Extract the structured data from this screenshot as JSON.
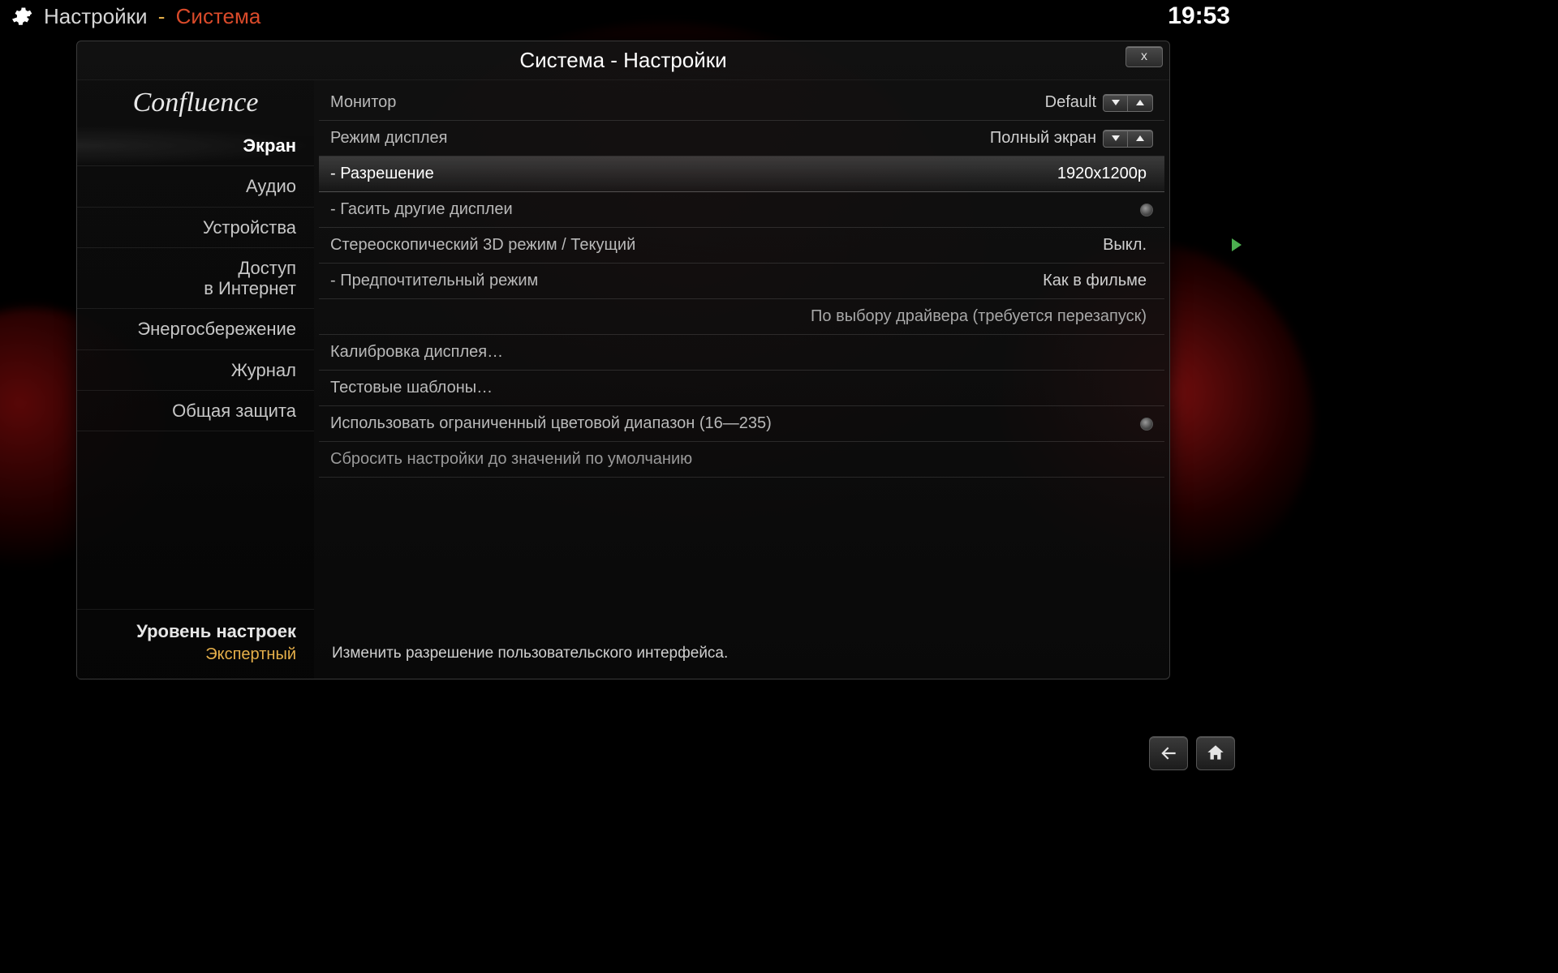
{
  "topbar": {
    "breadcrumb_section": "Настройки",
    "breadcrumb_page": "Система",
    "dash": "-",
    "clock": "19:53"
  },
  "window": {
    "title": "Система - Настройки",
    "close_label": "x",
    "logo": "Confluence"
  },
  "sidebar": {
    "items": [
      {
        "label": "Экран",
        "active": true
      },
      {
        "label": "Аудио"
      },
      {
        "label": "Устройства"
      },
      {
        "label": "Доступ\nв Интернет"
      },
      {
        "label": "Энергосбережение"
      },
      {
        "label": "Журнал"
      },
      {
        "label": "Общая защита"
      }
    ],
    "level_label": "Уровень настроек",
    "level_value": "Экспертный"
  },
  "settings": [
    {
      "label": "Монитор",
      "value": "Default",
      "spinner": true
    },
    {
      "label": "Режим дисплея",
      "value": "Полный экран",
      "spinner": true
    },
    {
      "label": "- Разрешение",
      "value": "1920x1200p",
      "highlight": true
    },
    {
      "label": "- Гасить другие дисплеи",
      "toggle": true
    },
    {
      "label": "Стереоскопический 3D режим / Текущий",
      "value": "Выкл."
    },
    {
      "label": "- Предпочтительный режим",
      "value": "Как в фильме"
    },
    {
      "label": "",
      "value": "По выбору драйвера (требуется перезапуск)",
      "right_only": true,
      "dim": true
    },
    {
      "label": "Калибровка дисплея…"
    },
    {
      "label": "Тестовые шаблоны…"
    },
    {
      "label": "Использовать ограниченный цветовой диапазон (16—235)",
      "toggle": true
    },
    {
      "label": "Сбросить настройки до значений по умолчанию",
      "dim": true
    }
  ],
  "hint": "Изменить разрешение пользовательского интерфейса."
}
